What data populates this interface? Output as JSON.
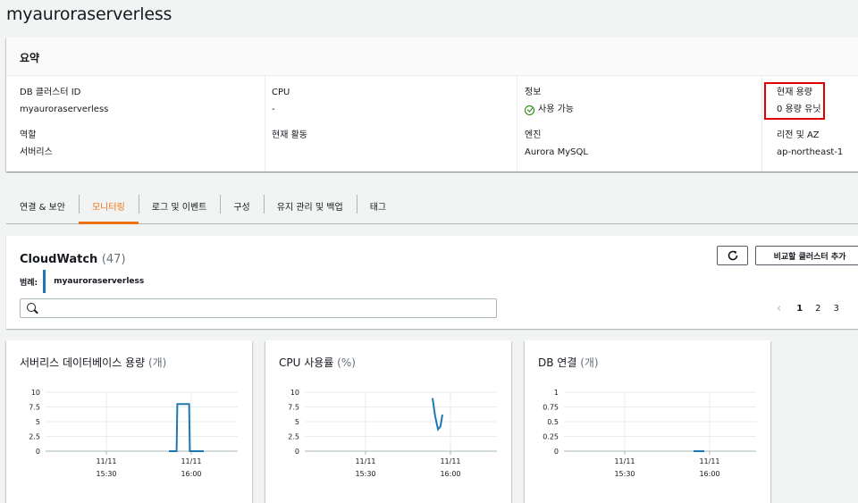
{
  "page": {
    "title": "myauroraserverless"
  },
  "summary": {
    "header": "요약",
    "fields": [
      {
        "key": "DB 클러스터 ID",
        "value": "myauroraserverless"
      },
      {
        "key": "CPU",
        "value": "-"
      },
      {
        "key": "정보",
        "value": "사용 가능"
      },
      {
        "key": "현재 용량",
        "value": "0 용량 유닛"
      },
      {
        "key": "역할",
        "value": "서버리스"
      },
      {
        "key": "현재 활동",
        "value": ""
      },
      {
        "key": "엔진",
        "value": "Aurora MySQL"
      },
      {
        "key": "리전 및 AZ",
        "value": "ap-northeast-1"
      }
    ],
    "status_color": "#1d8102",
    "highlight_color": "#e00000"
  },
  "tabs": [
    {
      "label": "연결 & 보안"
    },
    {
      "label": "모니터링",
      "active": true
    },
    {
      "label": "로그 및 이벤트"
    },
    {
      "label": "구성"
    },
    {
      "label": "유지 관리 및 백업"
    },
    {
      "label": "태그"
    }
  ],
  "cloudwatch": {
    "title": "CloudWatch",
    "count": "(47)",
    "legend_label": "범례:",
    "legend_item": "myauroraserverless",
    "legend_color": "#1f77b4",
    "refresh_icon": "refresh-icon",
    "add_button": "비교할 클러스터 추가",
    "search_placeholder": "",
    "pages": [
      "1",
      "2",
      "3"
    ],
    "current_page": "1"
  },
  "chart_data": [
    {
      "type": "line",
      "title": "서버리스 데이터베이스 용량",
      "unit": "(개)",
      "yticks": [
        "10",
        "7.5",
        "5",
        "2.5",
        "0"
      ],
      "ylim": [
        0,
        10
      ],
      "xticks": [
        [
          "11/11",
          "15:30"
        ],
        [
          "11/11",
          "16:00"
        ]
      ],
      "series": [
        {
          "points": [
            [
              0.0,
              0
            ],
            [
              0.22,
              0
            ],
            [
              0.24,
              8
            ],
            [
              0.58,
              8
            ],
            [
              0.6,
              0
            ],
            [
              1.0,
              0
            ]
          ]
        }
      ]
    },
    {
      "type": "line",
      "title": "CPU 사용률",
      "unit": "(%)",
      "yticks": [
        "10",
        "7.5",
        "5",
        "2.5",
        "0"
      ],
      "ylim": [
        0,
        10
      ],
      "xticks": [
        [
          "11/11",
          "15:30"
        ],
        [
          "11/11",
          "16:00"
        ]
      ],
      "series": [
        {
          "points": [
            [
              0.0,
              9.0
            ],
            [
              0.25,
              6.0
            ],
            [
              0.55,
              3.7
            ],
            [
              0.8,
              4.2
            ],
            [
              1.0,
              6.2
            ]
          ]
        }
      ]
    },
    {
      "type": "line",
      "title": "DB 연결",
      "unit": "(개)",
      "yticks": [
        "1",
        "0.75",
        "0.5",
        "0.25",
        "0"
      ],
      "ylim": [
        0,
        1
      ],
      "xticks": [
        [
          "11/11",
          "15:30"
        ],
        [
          "11/11",
          "16:00"
        ]
      ],
      "series": [
        {
          "points": [
            [
              0.0,
              0
            ],
            [
              1.0,
              0
            ]
          ]
        }
      ]
    }
  ]
}
